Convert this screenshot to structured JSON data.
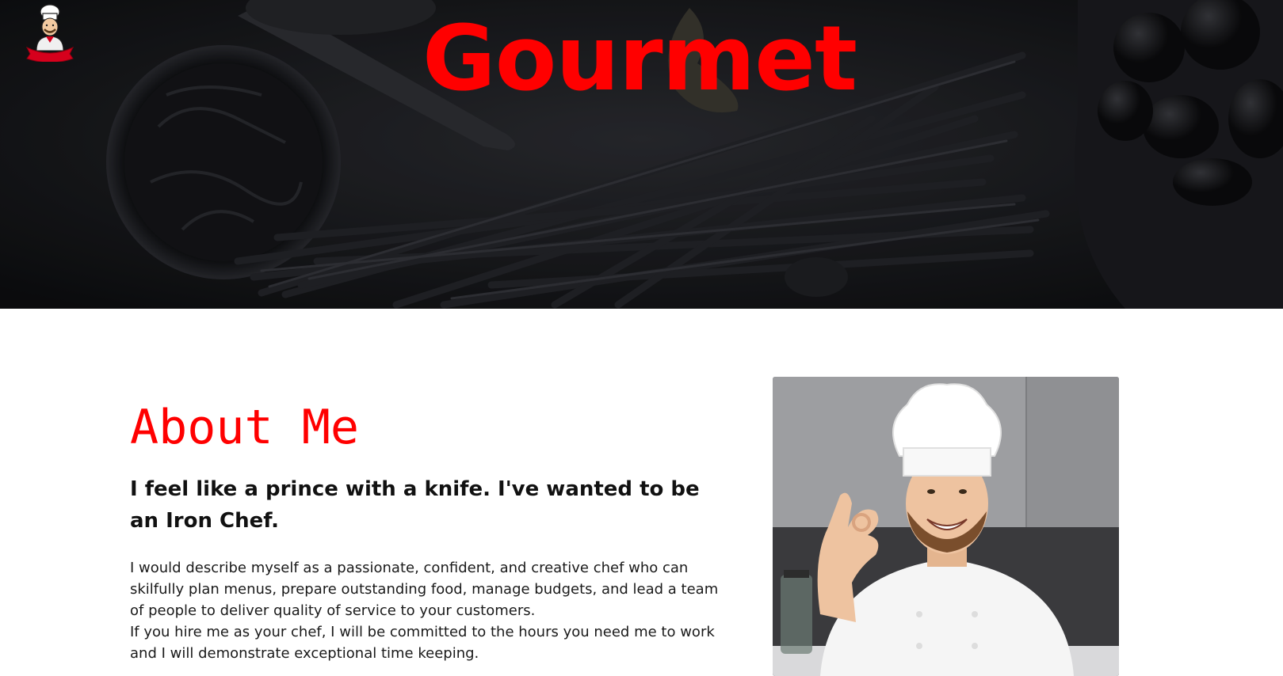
{
  "header": {
    "logo_icon": "chef-mascot-logo",
    "site_title": "Gourmet",
    "title_color": "#ff0000"
  },
  "about": {
    "title": "About Me",
    "subtitle": "I feel like a prince with a knife. I've wanted to be an Iron Chef.",
    "paragraphs": [
      "I would describe myself as a passionate, confident, and creative chef who can skilfully plan menus, prepare outstanding food, manage budgets, and lead a team of people to deliver quality of service to your customers.",
      "If you hire me as your chef, I will be committed to the hours you need me to work and I will demonstrate exceptional time keeping."
    ],
    "photo": "smiling-chef-ok-gesture-photo"
  },
  "colors": {
    "accent": "#ff0000",
    "hero_background": "#16171a",
    "body_text": "#1a1a1a"
  }
}
